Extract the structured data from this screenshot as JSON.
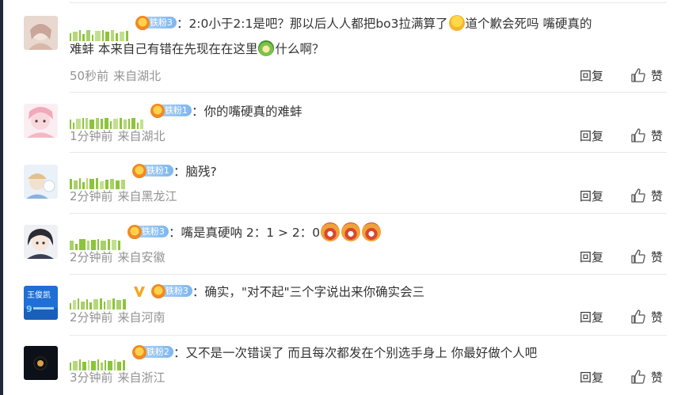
{
  "labels": {
    "reply": "回复",
    "like": "赞"
  },
  "comments": [
    {
      "fan_level": "铁粉3",
      "text_a": "：2:0小于2:1是吧？那以后人人都把bo3拉满算了",
      "text_b": "道个歉会死吗 嘴硬真的",
      "text_c": "难蚌 本来自己有错在先现在在这里",
      "text_d": "什么啊？",
      "time": "50秒前",
      "location": "来自湖北",
      "emojis": [
        "hug-emoji",
        "melon-emoji"
      ]
    },
    {
      "fan_level": "铁粉1",
      "text": "：你的嘴硬真的难蚌",
      "time": "1分钟前",
      "location": "来自湖北"
    },
    {
      "fan_level": "铁粉1",
      "text": "：脑残?",
      "time": "2分钟前",
      "location": "来自黑龙江"
    },
    {
      "fan_level": "铁粉3",
      "text": "：嘴是真硬呐 2：1 > 2：0",
      "time": "2分钟前",
      "location": "来自安徽",
      "emojis": [
        "laugh-cry-emoji",
        "laugh-cry-emoji",
        "laugh-cry-emoji"
      ]
    },
    {
      "fan_level": "铁粉3",
      "text": "：确实，\"对不起\"三个字说出来你确实会三",
      "time": "2分钟前",
      "location": "来自河南",
      "avatar_text": "王俊凯"
    },
    {
      "fan_level": "铁粉2",
      "text": "：又不是一次错误了 而且每次都发在个别选手身上 你最好做个人吧",
      "time": "3分钟前",
      "location": "来自浙江"
    }
  ],
  "colors": {
    "meta": "#939393",
    "badge": "#7db7ef",
    "username_mask": "#8cc43c",
    "verified": "#f5a623"
  }
}
